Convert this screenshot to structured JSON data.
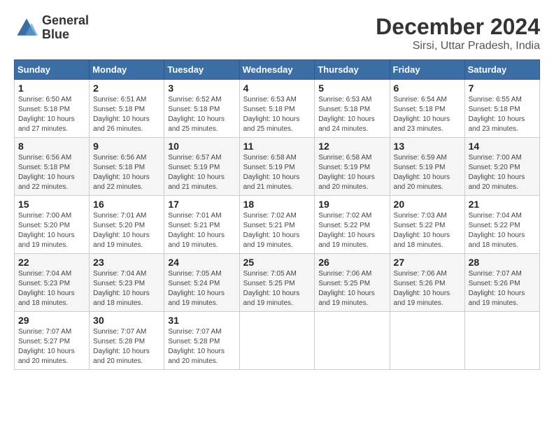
{
  "logo": {
    "line1": "General",
    "line2": "Blue"
  },
  "title": "December 2024",
  "location": "Sirsi, Uttar Pradesh, India",
  "days_of_week": [
    "Sunday",
    "Monday",
    "Tuesday",
    "Wednesday",
    "Thursday",
    "Friday",
    "Saturday"
  ],
  "weeks": [
    [
      {
        "day": "1",
        "sunrise": "6:50 AM",
        "sunset": "5:18 PM",
        "daylight": "10 hours and 27 minutes."
      },
      {
        "day": "2",
        "sunrise": "6:51 AM",
        "sunset": "5:18 PM",
        "daylight": "10 hours and 26 minutes."
      },
      {
        "day": "3",
        "sunrise": "6:52 AM",
        "sunset": "5:18 PM",
        "daylight": "10 hours and 25 minutes."
      },
      {
        "day": "4",
        "sunrise": "6:53 AM",
        "sunset": "5:18 PM",
        "daylight": "10 hours and 25 minutes."
      },
      {
        "day": "5",
        "sunrise": "6:53 AM",
        "sunset": "5:18 PM",
        "daylight": "10 hours and 24 minutes."
      },
      {
        "day": "6",
        "sunrise": "6:54 AM",
        "sunset": "5:18 PM",
        "daylight": "10 hours and 23 minutes."
      },
      {
        "day": "7",
        "sunrise": "6:55 AM",
        "sunset": "5:18 PM",
        "daylight": "10 hours and 23 minutes."
      }
    ],
    [
      {
        "day": "8",
        "sunrise": "6:56 AM",
        "sunset": "5:18 PM",
        "daylight": "10 hours and 22 minutes."
      },
      {
        "day": "9",
        "sunrise": "6:56 AM",
        "sunset": "5:18 PM",
        "daylight": "10 hours and 22 minutes."
      },
      {
        "day": "10",
        "sunrise": "6:57 AM",
        "sunset": "5:19 PM",
        "daylight": "10 hours and 21 minutes."
      },
      {
        "day": "11",
        "sunrise": "6:58 AM",
        "sunset": "5:19 PM",
        "daylight": "10 hours and 21 minutes."
      },
      {
        "day": "12",
        "sunrise": "6:58 AM",
        "sunset": "5:19 PM",
        "daylight": "10 hours and 20 minutes."
      },
      {
        "day": "13",
        "sunrise": "6:59 AM",
        "sunset": "5:19 PM",
        "daylight": "10 hours and 20 minutes."
      },
      {
        "day": "14",
        "sunrise": "7:00 AM",
        "sunset": "5:20 PM",
        "daylight": "10 hours and 20 minutes."
      }
    ],
    [
      {
        "day": "15",
        "sunrise": "7:00 AM",
        "sunset": "5:20 PM",
        "daylight": "10 hours and 19 minutes."
      },
      {
        "day": "16",
        "sunrise": "7:01 AM",
        "sunset": "5:20 PM",
        "daylight": "10 hours and 19 minutes."
      },
      {
        "day": "17",
        "sunrise": "7:01 AM",
        "sunset": "5:21 PM",
        "daylight": "10 hours and 19 minutes."
      },
      {
        "day": "18",
        "sunrise": "7:02 AM",
        "sunset": "5:21 PM",
        "daylight": "10 hours and 19 minutes."
      },
      {
        "day": "19",
        "sunrise": "7:02 AM",
        "sunset": "5:22 PM",
        "daylight": "10 hours and 19 minutes."
      },
      {
        "day": "20",
        "sunrise": "7:03 AM",
        "sunset": "5:22 PM",
        "daylight": "10 hours and 18 minutes."
      },
      {
        "day": "21",
        "sunrise": "7:04 AM",
        "sunset": "5:22 PM",
        "daylight": "10 hours and 18 minutes."
      }
    ],
    [
      {
        "day": "22",
        "sunrise": "7:04 AM",
        "sunset": "5:23 PM",
        "daylight": "10 hours and 18 minutes."
      },
      {
        "day": "23",
        "sunrise": "7:04 AM",
        "sunset": "5:23 PM",
        "daylight": "10 hours and 18 minutes."
      },
      {
        "day": "24",
        "sunrise": "7:05 AM",
        "sunset": "5:24 PM",
        "daylight": "10 hours and 19 minutes."
      },
      {
        "day": "25",
        "sunrise": "7:05 AM",
        "sunset": "5:25 PM",
        "daylight": "10 hours and 19 minutes."
      },
      {
        "day": "26",
        "sunrise": "7:06 AM",
        "sunset": "5:25 PM",
        "daylight": "10 hours and 19 minutes."
      },
      {
        "day": "27",
        "sunrise": "7:06 AM",
        "sunset": "5:26 PM",
        "daylight": "10 hours and 19 minutes."
      },
      {
        "day": "28",
        "sunrise": "7:07 AM",
        "sunset": "5:26 PM",
        "daylight": "10 hours and 19 minutes."
      }
    ],
    [
      {
        "day": "29",
        "sunrise": "7:07 AM",
        "sunset": "5:27 PM",
        "daylight": "10 hours and 20 minutes."
      },
      {
        "day": "30",
        "sunrise": "7:07 AM",
        "sunset": "5:28 PM",
        "daylight": "10 hours and 20 minutes."
      },
      {
        "day": "31",
        "sunrise": "7:07 AM",
        "sunset": "5:28 PM",
        "daylight": "10 hours and 20 minutes."
      },
      null,
      null,
      null,
      null
    ]
  ]
}
